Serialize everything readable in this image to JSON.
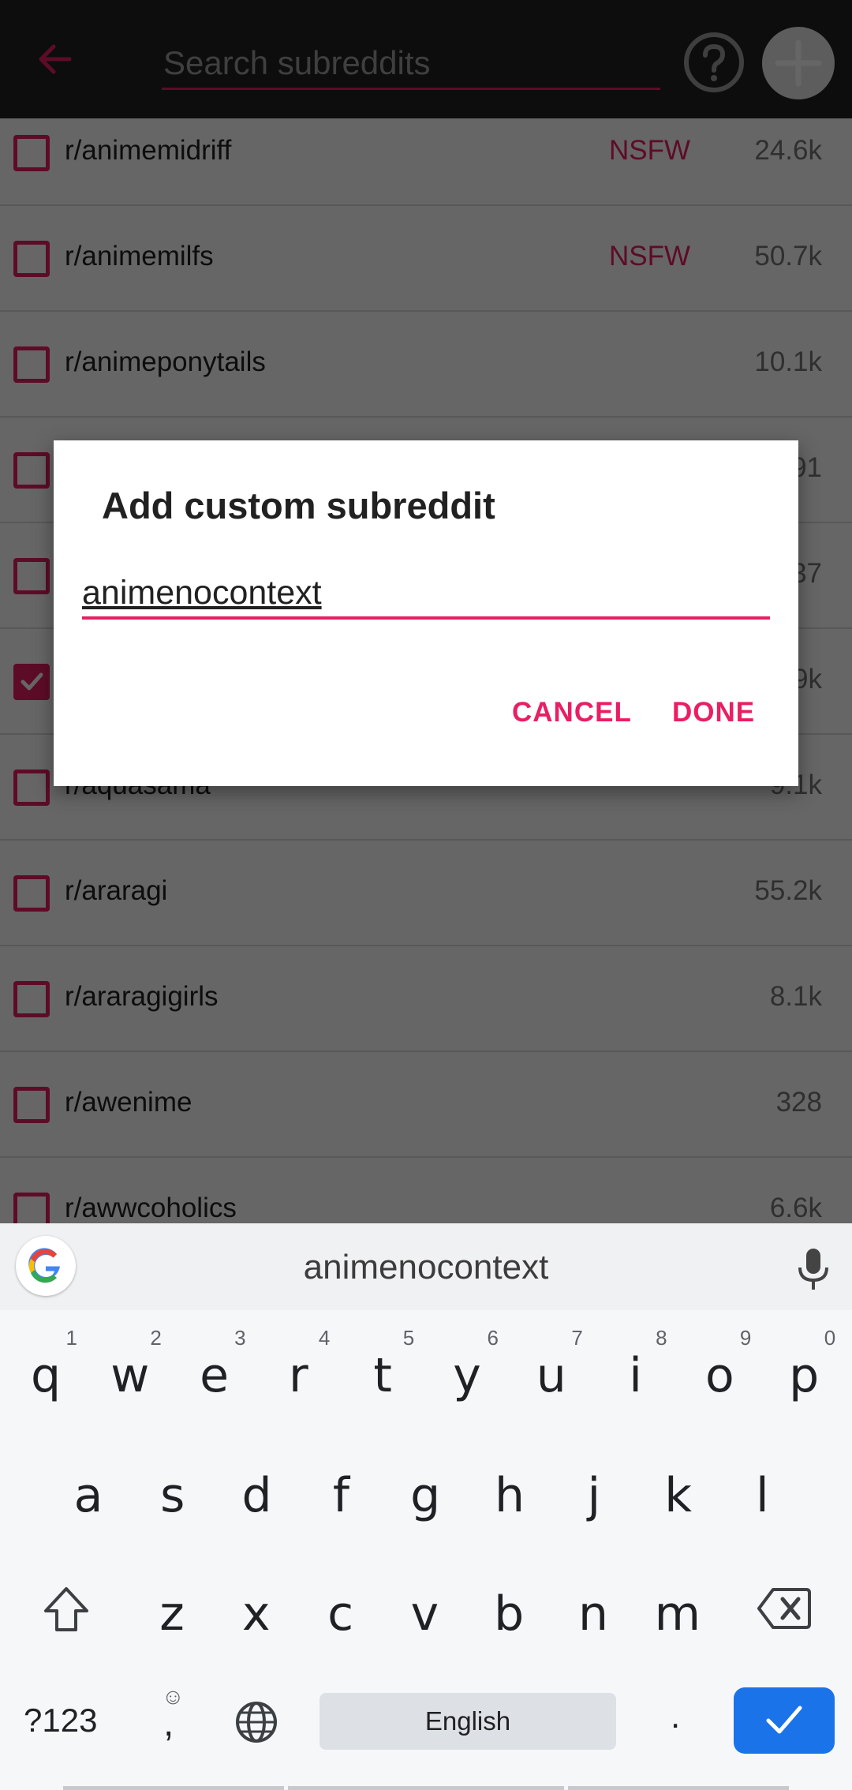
{
  "toolbar": {
    "search_placeholder": "Search subreddits",
    "back_icon": "arrow-left-icon",
    "help_icon": "question-circle-icon",
    "add_icon": "plus-circle-icon"
  },
  "subreddits": [
    {
      "name": "r/animemidriff",
      "nsfw": "NSFW",
      "count": "24.6k",
      "checked": false
    },
    {
      "name": "r/animemilfs",
      "nsfw": "NSFW",
      "count": "50.7k",
      "checked": false
    },
    {
      "name": "r/animeponytails",
      "nsfw": "",
      "count": "10.1k",
      "checked": false
    },
    {
      "name": "",
      "nsfw": "",
      "count": "91",
      "checked": false
    },
    {
      "name": "",
      "nsfw": "",
      "count": "37",
      "checked": false
    },
    {
      "name": "",
      "nsfw": "",
      "count": "9k",
      "checked": true
    },
    {
      "name": "r/aquasama",
      "nsfw": "",
      "count": "9.1k",
      "checked": false
    },
    {
      "name": "r/araragi",
      "nsfw": "",
      "count": "55.2k",
      "checked": false
    },
    {
      "name": "r/araragigirls",
      "nsfw": "",
      "count": "8.1k",
      "checked": false
    },
    {
      "name": "r/awenime",
      "nsfw": "",
      "count": "328",
      "checked": false
    },
    {
      "name": "r/awwcoholics",
      "nsfw": "",
      "count": "6.6k",
      "checked": false
    }
  ],
  "dialog": {
    "title": "Add custom subreddit",
    "input_value": "animenocontext",
    "cancel_label": "CANCEL",
    "done_label": "DONE"
  },
  "keyboard": {
    "suggestion": "animenocontext",
    "row1": [
      {
        "ch": "q",
        "hint": "1"
      },
      {
        "ch": "w",
        "hint": "2"
      },
      {
        "ch": "e",
        "hint": "3"
      },
      {
        "ch": "r",
        "hint": "4"
      },
      {
        "ch": "t",
        "hint": "5"
      },
      {
        "ch": "y",
        "hint": "6"
      },
      {
        "ch": "u",
        "hint": "7"
      },
      {
        "ch": "i",
        "hint": "8"
      },
      {
        "ch": "o",
        "hint": "9"
      },
      {
        "ch": "p",
        "hint": "0"
      }
    ],
    "row2": [
      "a",
      "s",
      "d",
      "f",
      "g",
      "h",
      "j",
      "k",
      "l"
    ],
    "row3": [
      "z",
      "x",
      "c",
      "v",
      "b",
      "n",
      "m"
    ],
    "symbols_label": "?123",
    "comma_label": ",",
    "emoji_glyph": "☺",
    "space_label": "English",
    "period_label": ".",
    "shift_icon": "shift-icon",
    "backspace_icon": "backspace-icon",
    "globe_icon": "globe-icon",
    "enter_icon": "check-icon",
    "mic_icon": "microphone-icon",
    "logo_icon": "google-logo-icon"
  },
  "colors": {
    "accent": "#e91e63",
    "toolbar": "#212121",
    "enter_key": "#1a73e8"
  }
}
